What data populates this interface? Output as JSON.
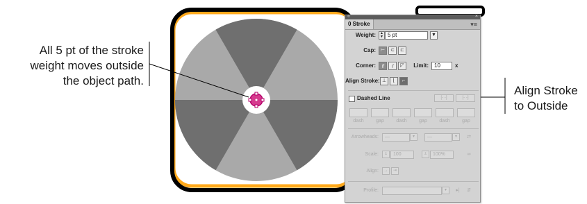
{
  "callouts": {
    "left": [
      "All 5 pt of the stroke",
      "weight moves outside",
      "the object path."
    ],
    "right": [
      "Align Stroke",
      "to Outside"
    ]
  },
  "colors": {
    "artboard_border": "#ffa81a",
    "frame": "#000000",
    "disc_dark": "#6f6f6f",
    "disc_light": "#a9a9a9",
    "path_point": "#d63a8e"
  },
  "panel": {
    "tab_label": "0 Stroke",
    "menu_icon": "panel-menu-icon",
    "weight": {
      "label": "Weight:",
      "value": "5 pt"
    },
    "cap": {
      "label": "Cap:"
    },
    "corner": {
      "label": "Corner:",
      "limit_label": "Limit:",
      "limit_value": "10",
      "limit_suffix": "x"
    },
    "align_stroke": {
      "label": "Align Stroke:",
      "selected": "outside"
    },
    "dashed_line": {
      "label": "Dashed Line",
      "checked": false
    },
    "dash_labels": [
      "dash",
      "gap",
      "dash",
      "gap",
      "dash",
      "gap"
    ],
    "arrowheads": {
      "label": "Arrowheads:"
    },
    "scale": {
      "label": "Scale:",
      "start": "100",
      "end": "100%"
    },
    "align": {
      "label": "Align:"
    },
    "profile": {
      "label": "Profile:"
    }
  }
}
